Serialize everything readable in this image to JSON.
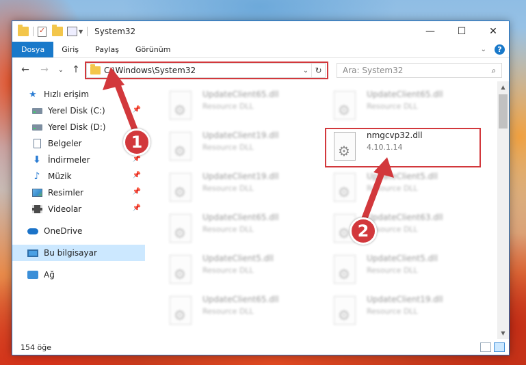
{
  "window": {
    "title": "System32",
    "controls": {
      "minimize": "—",
      "maximize": "☐",
      "close": "✕"
    }
  },
  "ribbon": {
    "tabs": [
      "Dosya",
      "Giriş",
      "Paylaş",
      "Görünüm"
    ],
    "expand": "⌄",
    "help": "?"
  },
  "nav": {
    "back": "←",
    "forward": "→",
    "recent": "⌄",
    "up": "↑"
  },
  "address": {
    "path": "C:\\Windows\\System32",
    "dropdown": "⌄",
    "refresh": "↻"
  },
  "search": {
    "placeholder": "Ara: System32",
    "icon": "⌕"
  },
  "sidebar": {
    "quick_access": "Hızlı erişim",
    "items": [
      {
        "label": "Yerel Disk (C:)",
        "icon": "drive-icon"
      },
      {
        "label": "Yerel Disk (D:)",
        "icon": "drive-icon"
      },
      {
        "label": "Belgeler",
        "icon": "document-icon"
      },
      {
        "label": "İndirmeler",
        "icon": "download-icon"
      },
      {
        "label": "Müzik",
        "icon": "music-icon"
      },
      {
        "label": "Resimler",
        "icon": "pictures-icon"
      },
      {
        "label": "Videolar",
        "icon": "video-icon"
      }
    ],
    "onedrive": "OneDrive",
    "this_pc": "Bu bilgisayar",
    "network": "Ağ"
  },
  "files": {
    "left": [
      {
        "name": "UpdateClient65.dll",
        "type": "Resource DLL"
      },
      {
        "name": "UpdateClient19.dll",
        "type": "Resource DLL"
      },
      {
        "name": "UpdateClient19.dll",
        "type": "Resource DLL"
      },
      {
        "name": "UpdateClient65.dll",
        "type": "Resource DLL"
      },
      {
        "name": "UpdateClient5.dll",
        "type": "Resource DLL"
      },
      {
        "name": "UpdateClient65.dll",
        "type": "Resource DLL"
      }
    ],
    "right": [
      {
        "name": "UpdateClient65.dll",
        "type": "Resource DLL"
      },
      {
        "name": "UpdateClient5.dll",
        "type": "Resource DLL"
      },
      {
        "name": "UpdateClient63.dll",
        "type": "Resource DLL"
      },
      {
        "name": "UpdateClient5.dll",
        "type": "Resource DLL"
      },
      {
        "name": "UpdateClient19.dll",
        "type": "Resource DLL"
      }
    ],
    "target": {
      "name": "nmgcvp32.dll",
      "version": "4.10.1.14"
    }
  },
  "status": {
    "count": "154 öğe"
  },
  "annotations": {
    "badge1": "1",
    "badge2": "2",
    "accent": "#d2383c"
  }
}
